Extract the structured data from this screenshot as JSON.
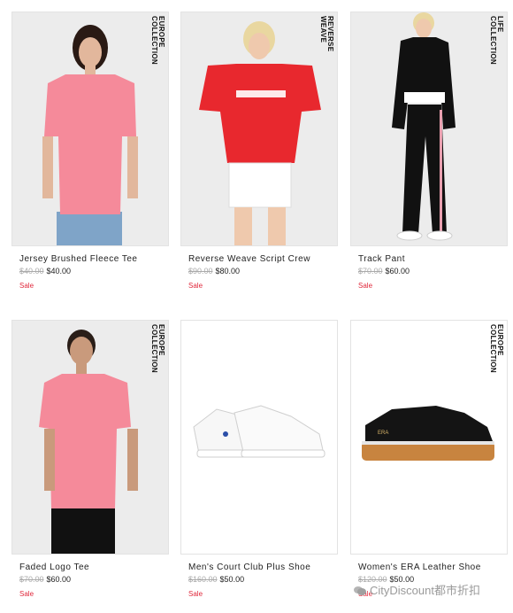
{
  "products": [
    {
      "name": "Jersey Brushed Fleece Tee",
      "was": "$40.00",
      "now": "$40.00",
      "badge": "Sale",
      "tag": [
        "EUROPE",
        "COLLECTION"
      ]
    },
    {
      "name": "Reverse Weave Script Crew",
      "was": "$90.00",
      "now": "$80.00",
      "badge": "Sale",
      "tag": [
        "REVERSE",
        "WEAVE"
      ]
    },
    {
      "name": "Track Pant",
      "was": "$70.00",
      "now": "$60.00",
      "badge": "Sale",
      "tag": [
        "LIFE",
        "COLLECTION"
      ]
    },
    {
      "name": "Faded Logo Tee",
      "was": "$70.00",
      "now": "$60.00",
      "badge": "Sale",
      "tag": [
        "EUROPE",
        "COLLECTION"
      ]
    },
    {
      "name": "Men's Court Club Plus Shoe",
      "was": "$160.00",
      "now": "$50.00",
      "badge": "Sale",
      "tag": []
    },
    {
      "name": "Women's ERA Leather Shoe",
      "was": "$120.00",
      "now": "$50.00",
      "badge": "Sale",
      "tag": [
        "EUROPE",
        "COLLECTION"
      ]
    }
  ],
  "watermark": "CityDiscount都市折扣",
  "colors": {
    "sale": "#e0283b",
    "pink": "#f58a9a",
    "red": "#e8282e",
    "black": "#111111",
    "gum": "#c8843f"
  }
}
